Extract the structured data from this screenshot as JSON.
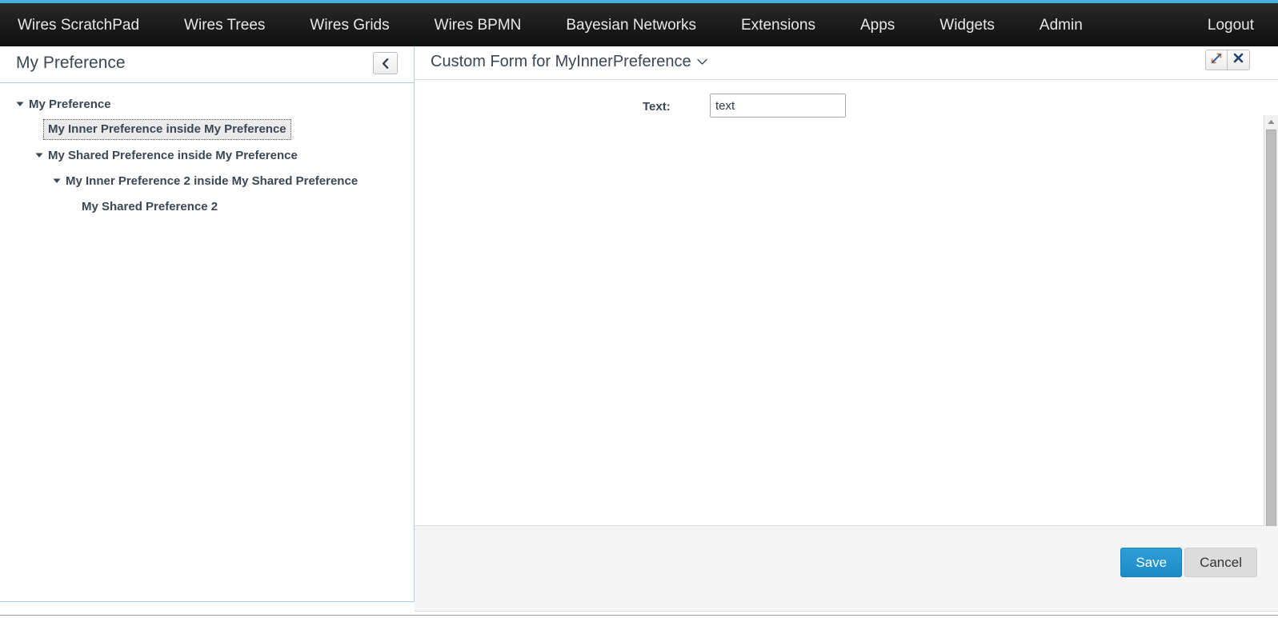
{
  "navbar": {
    "left_items": [
      {
        "label": "Wires ScratchPad",
        "name": "nav-wires-scratchpad"
      },
      {
        "label": "Wires Trees",
        "name": "nav-wires-trees"
      },
      {
        "label": "Wires Grids",
        "name": "nav-wires-grids"
      },
      {
        "label": "Wires BPMN",
        "name": "nav-wires-bpmn"
      },
      {
        "label": "Bayesian Networks",
        "name": "nav-bayesian-networks"
      },
      {
        "label": "Extensions",
        "name": "nav-extensions"
      },
      {
        "label": "Apps",
        "name": "nav-apps"
      },
      {
        "label": "Widgets",
        "name": "nav-widgets"
      },
      {
        "label": "Admin",
        "name": "nav-admin"
      }
    ],
    "right_item": "Logout",
    "accent_color": "#4aaede"
  },
  "sidebar": {
    "title": "My Preference",
    "collapse_icon": "chevron-left-icon",
    "tree": [
      {
        "label": "My Preference",
        "level": 1,
        "caret": "caret-down-icon",
        "selected": false
      },
      {
        "label": "My Inner Preference inside My Preference",
        "level": 2,
        "caret": "",
        "selected": true
      },
      {
        "label": "My Shared Preference inside My Preference",
        "level": 2,
        "caret": "caret-down-icon",
        "selected": false
      },
      {
        "label": "My Inner Preference 2 inside My Shared Preference",
        "level": 3,
        "caret": "caret-down-icon",
        "selected": false
      },
      {
        "label": "My Shared Preference 2",
        "level": 4,
        "caret": "",
        "selected": false
      }
    ]
  },
  "form": {
    "title": "Custom Form for MyInnerPreference",
    "title_caret": "chevron-down-icon",
    "expand_icon": "expand-arrows-icon",
    "close_icon": "close-x-icon",
    "fields": [
      {
        "label": "Text:",
        "value": "text",
        "placeholder": ""
      }
    ],
    "save_label": "Save",
    "cancel_label": "Cancel",
    "save_color": "#1b8ac6"
  }
}
